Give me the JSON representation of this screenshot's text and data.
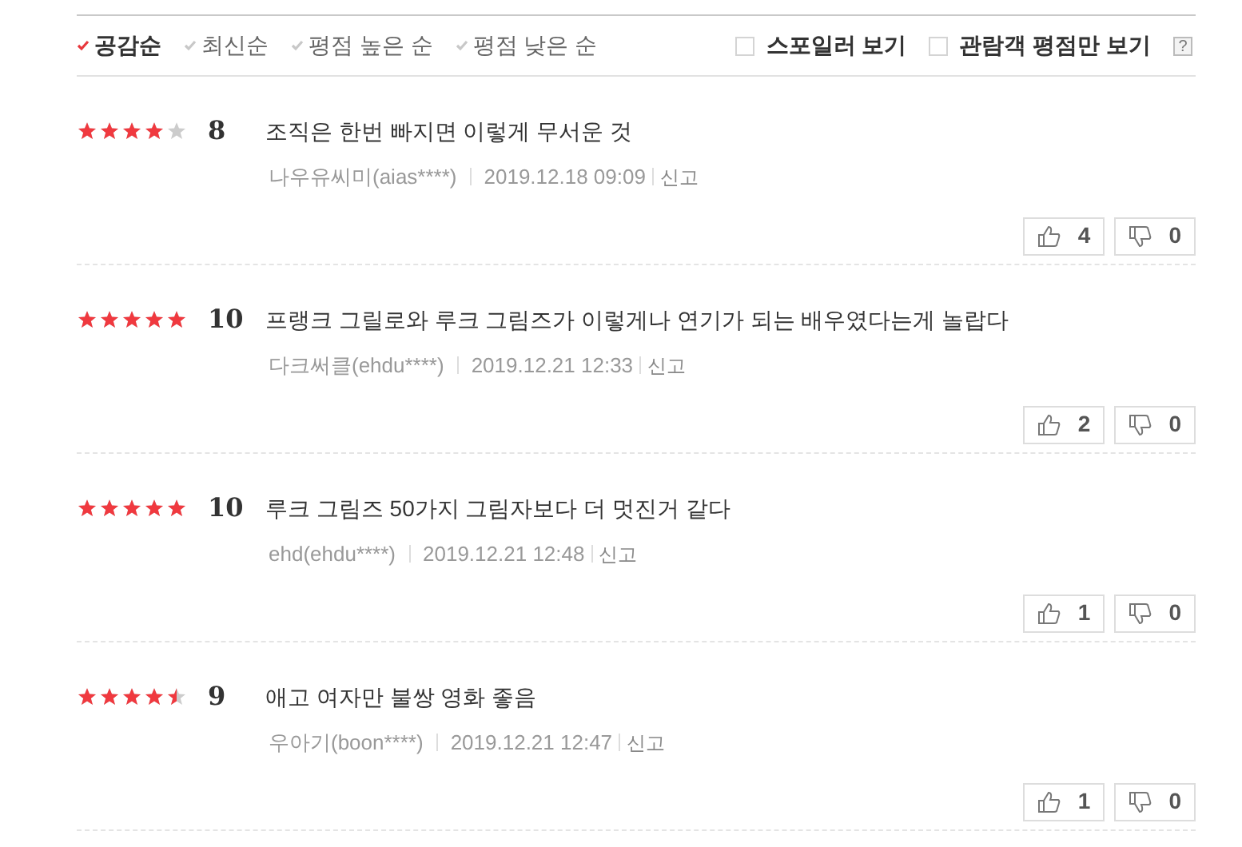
{
  "sort_options": [
    {
      "label": "공감순",
      "selected": true
    },
    {
      "label": "최신순",
      "selected": false
    },
    {
      "label": "평점 높은 순",
      "selected": false
    },
    {
      "label": "평점 낮은 순",
      "selected": false
    }
  ],
  "filters": [
    {
      "label": "스포일러 보기",
      "checked": false
    },
    {
      "label": "관람객 평점만 보기",
      "checked": false
    }
  ],
  "help": "?",
  "reviews": [
    {
      "stars": 4,
      "score": "8",
      "text": "조직은 한번 빠지면 이렇게 무서운 것",
      "author": "나우유씨미(aias****)",
      "date": "2019.12.18 09:09",
      "report": "신고",
      "likes": "4",
      "dislikes": "0"
    },
    {
      "stars": 5,
      "score": "10",
      "text": "프랭크 그릴로와 루크 그림즈가 이렇게나 연기가 되는 배우였다는게 놀랍다",
      "author": "다크써클(ehdu****)",
      "date": "2019.12.21 12:33",
      "report": "신고",
      "likes": "2",
      "dislikes": "0"
    },
    {
      "stars": 5,
      "score": "10",
      "text": "루크 그림즈 50가지 그림자보다 더 멋진거 같다",
      "author": "ehd(ehdu****)",
      "date": "2019.12.21 12:48",
      "report": "신고",
      "likes": "1",
      "dislikes": "0"
    },
    {
      "stars": 4.5,
      "score": "9",
      "text": "애고 여자만 불쌍 영화 좋음",
      "author": "우아기(boon****)",
      "date": "2019.12.21 12:47",
      "report": "신고",
      "likes": "1",
      "dislikes": "0"
    }
  ]
}
